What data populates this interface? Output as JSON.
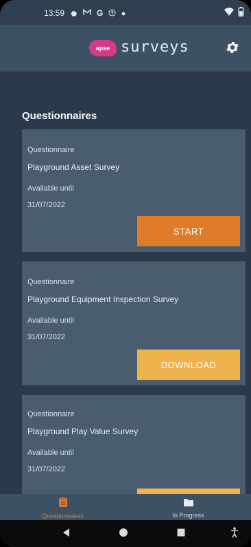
{
  "status_bar": {
    "time": "13:59",
    "icons": [
      "gear-icon",
      "gmail-icon",
      "google-icon",
      "accessibility-icon",
      "dot-icon"
    ],
    "right_icons": [
      "wifi-icon",
      "battery-icon"
    ]
  },
  "header": {
    "logo_text": "apse",
    "brand": "surveys",
    "settings_icon": "gear-icon"
  },
  "main": {
    "section_title": "Questionnaires",
    "cards": [
      {
        "type_label": "Questionnaire",
        "name": "Playground Asset Survey",
        "available_label": "Available until",
        "date": "31/07/2022",
        "action": "START"
      },
      {
        "type_label": "Questionnaire",
        "name": "Playground Equipment Inspection Survey",
        "available_label": "Available until",
        "date": "31/07/2022",
        "action": "DOWNLOAD"
      },
      {
        "type_label": "Questionnaire",
        "name": "Playground Play Value Survey",
        "available_label": "Available until",
        "date": "31/07/2022",
        "action": ""
      }
    ]
  },
  "bottom_nav": {
    "items": [
      {
        "label": "Questionnaires",
        "icon": "clipboard-icon",
        "active": true
      },
      {
        "label": "In Progress",
        "icon": "folder-icon",
        "active": false
      }
    ]
  },
  "system_nav": {
    "icons": [
      "back-icon",
      "home-icon",
      "recents-icon",
      "accessibility-icon"
    ]
  },
  "colors": {
    "background": "#2a3a4b",
    "header": "#3d5165",
    "card": "#4a5d6f",
    "start_button": "#e07b2a",
    "download_button": "#f0b24c",
    "active_nav": "#e07b2a"
  }
}
